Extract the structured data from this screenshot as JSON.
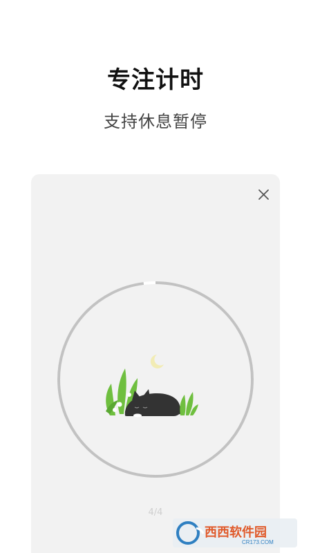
{
  "header": {
    "title": "专注计时",
    "subtitle": "支持休息暂停"
  },
  "card": {
    "close_icon": "close-icon",
    "timer": {
      "progress": 0.98,
      "illustration": "sleeping-cat-with-plants-and-moon"
    },
    "pager_text": "4/4"
  },
  "watermark": {
    "text": "西西软件园",
    "url_text": "CR173.COM"
  },
  "colors": {
    "ring": "#c2c2c2",
    "card_bg": "#f2f2f2",
    "cat": "#333333",
    "plant": "#6fbf3f",
    "moon": "#f2ecb4"
  }
}
